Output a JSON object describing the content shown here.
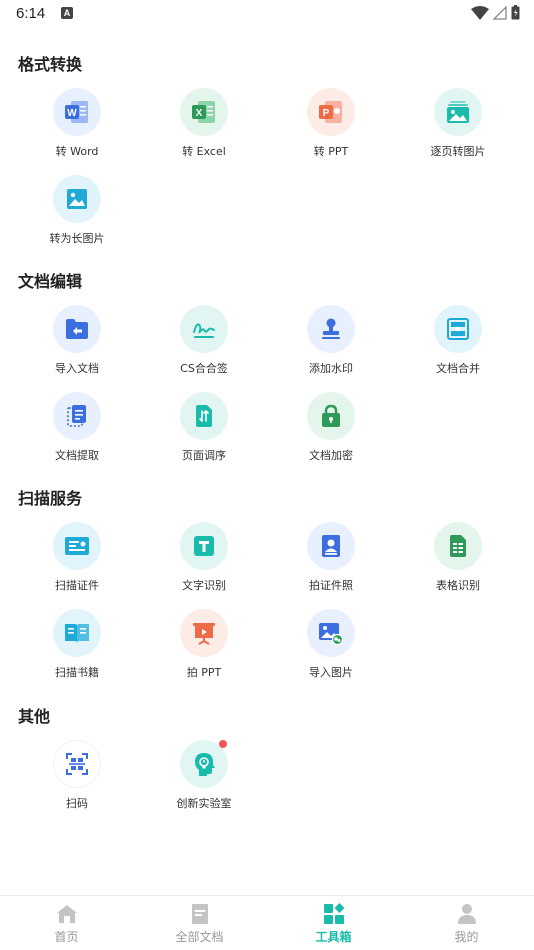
{
  "status": {
    "time": "6:14",
    "notif_icon": "A"
  },
  "sections": [
    {
      "title": "格式转换",
      "tools": [
        {
          "label": "转 Word",
          "icon": "word-icon"
        },
        {
          "label": "转 Excel",
          "icon": "excel-icon"
        },
        {
          "label": "转 PPT",
          "icon": "ppt-icon"
        },
        {
          "label": "逐页转图片",
          "icon": "pages-to-image-icon"
        },
        {
          "label": "转为长图片",
          "icon": "long-image-icon"
        }
      ]
    },
    {
      "title": "文档编辑",
      "tools": [
        {
          "label": "导入文档",
          "icon": "import-doc-icon"
        },
        {
          "label": "CS合合签",
          "icon": "signature-icon"
        },
        {
          "label": "添加水印",
          "icon": "stamp-icon"
        },
        {
          "label": "文档合并",
          "icon": "merge-icon"
        },
        {
          "label": "文档提取",
          "icon": "extract-icon"
        },
        {
          "label": "页面调序",
          "icon": "reorder-icon"
        },
        {
          "label": "文档加密",
          "icon": "lock-icon"
        }
      ]
    },
    {
      "title": "扫描服务",
      "tools": [
        {
          "label": "扫描证件",
          "icon": "id-card-icon"
        },
        {
          "label": "文字识别",
          "icon": "text-recognition-icon"
        },
        {
          "label": "拍证件照",
          "icon": "id-photo-icon"
        },
        {
          "label": "表格识别",
          "icon": "table-recognition-icon"
        },
        {
          "label": "扫描书籍",
          "icon": "book-scan-icon"
        },
        {
          "label": "拍 PPT",
          "icon": "ppt-capture-icon"
        },
        {
          "label": "导入图片",
          "icon": "import-image-icon"
        }
      ]
    },
    {
      "title": "其他",
      "tools": [
        {
          "label": "扫码",
          "icon": "qr-scan-icon"
        },
        {
          "label": "创新实验室",
          "icon": "innovation-lab-icon"
        }
      ]
    }
  ],
  "nav": [
    {
      "label": "首页",
      "icon": "home-icon",
      "active": false
    },
    {
      "label": "全部文档",
      "icon": "documents-icon",
      "active": false
    },
    {
      "label": "工具箱",
      "icon": "toolbox-icon",
      "active": true
    },
    {
      "label": "我的",
      "icon": "profile-icon",
      "active": false
    }
  ],
  "colors": {
    "accent": "#19bcaa",
    "word": "#3b6fe0",
    "excel": "#2e9a5a",
    "ppt": "#ee6b47",
    "teal": "#19bcaa",
    "badge": "#f25454"
  }
}
